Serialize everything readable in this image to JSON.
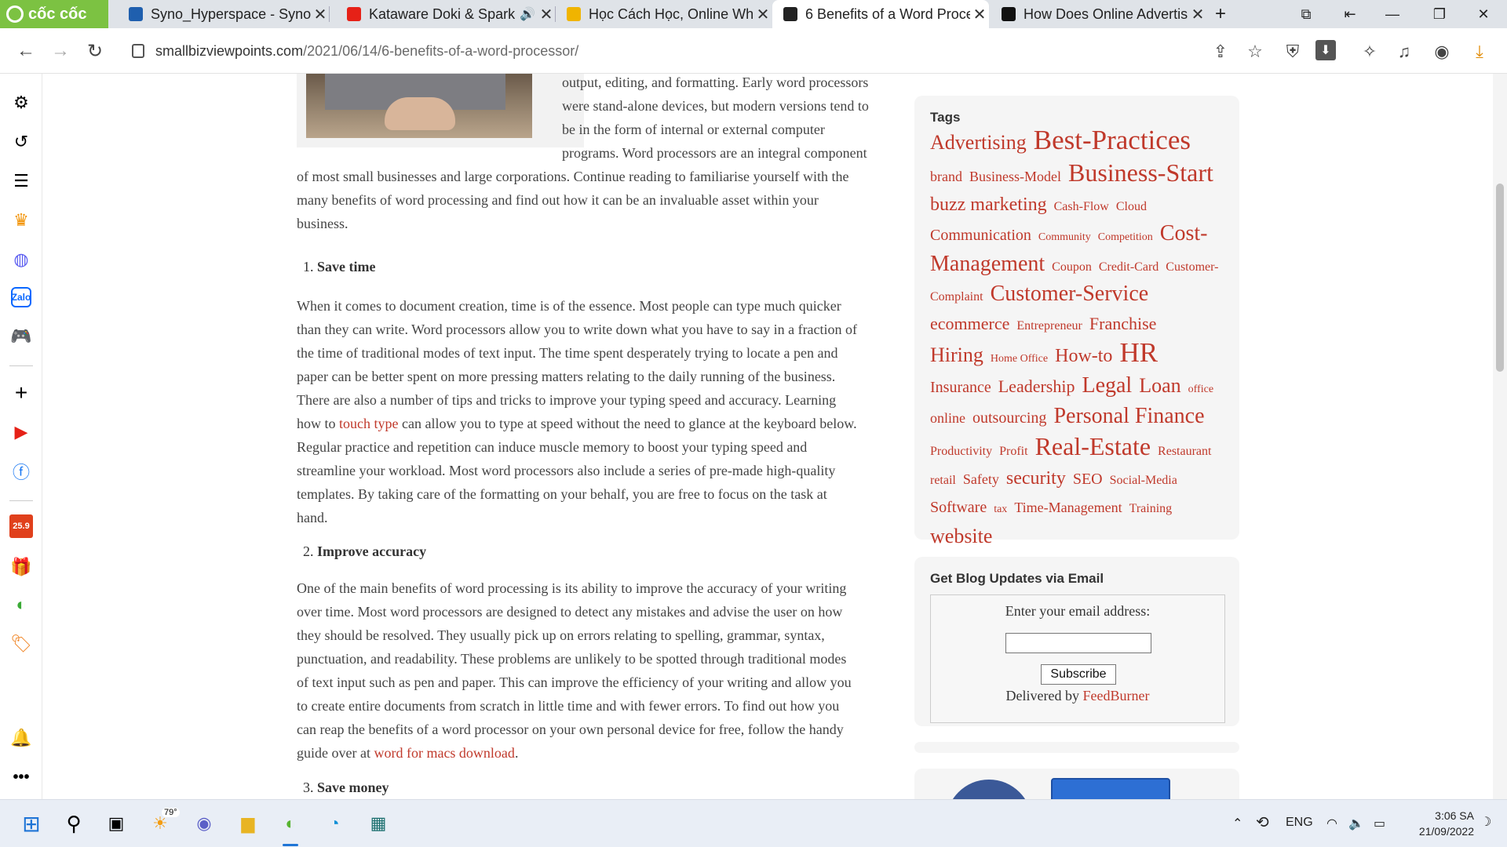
{
  "browser": {
    "logo": "cốc cốc",
    "tabs": [
      {
        "title": "Syno_Hyperspace - Synolo",
        "fav_color": "#1f5fae"
      },
      {
        "title": "Kataware Doki & Spark",
        "fav_color": "#e62117"
      },
      {
        "title": "Học Cách Học, Online Wh",
        "fav_color": "#f0b400"
      },
      {
        "title": "6 Benefits of a Word Proce",
        "fav_color": "#222222"
      },
      {
        "title": "How Does Online Advertis",
        "fav_color": "#111111"
      }
    ],
    "url_domain": "smallbizviewpoints.com",
    "url_path": "/2021/06/14/6-benefits-of-a-word-processor/"
  },
  "article": {
    "intro_lines": [
      "output, editing, and formatting. Early word processors",
      "were stand-alone devices, but modern versions tend to",
      "be in the form of internal or external computer",
      "programs. Word processors are an integral component"
    ],
    "intro_rest": [
      "of most small businesses and large corporations. Continue reading to familiarise yourself with the",
      "many benefits of word processing and find out how it can be an invaluable asset within your",
      "business."
    ],
    "h1_num": "1.",
    "h1": "Save time",
    "p1": [
      "When it comes to document creation, time is of the essence. Most people can type much quicker",
      "than they can write. Word processors allow you to write down what you have to say in a fraction of",
      "the time of traditional modes of text input. The time spent desperately trying to locate a pen and",
      "paper can be better spent on more pressing matters relating to the daily running of the business.",
      "There are also a number of tips and tricks to improve your typing speed and accuracy. Learning"
    ],
    "p1_link_pre": "how to ",
    "p1_link": "touch type",
    "p1_link_post": " can allow you to type at speed without the need to glance at the keyboard below.",
    "p1_tail": [
      "Regular practice and repetition can induce muscle memory to boost your typing speed and",
      "streamline your workload. Most word processors also include a series of pre-made high-quality",
      "templates. By taking care of the formatting on your behalf, you are free to focus on the task at",
      "hand."
    ],
    "h2_num": "2.",
    "h2": "Improve accuracy",
    "p2": [
      "One of the main benefits of word processing is its ability to improve the accuracy of your writing",
      "over time. Most word processors are designed to detect any mistakes and advise the user on how",
      "they should be resolved. They usually pick up on errors relating to spelling, grammar, syntax,",
      "punctuation, and readability. These problems are unlikely to be spotted through traditional modes",
      "of text input such as pen and paper. This can improve the efficiency of your writing and allow you",
      "to create entire documents from scratch in little time and with fewer errors. To find out how you",
      "can reap the benefits of a word processor on your own personal device for free, follow the handy"
    ],
    "p2_link_pre": "guide over at ",
    "p2_link": "word for macs download",
    "p2_link_post": ".",
    "h3_num": "3.",
    "h3": "Save money"
  },
  "sidebar_widgets": {
    "tags_title": "Tags",
    "tags": [
      {
        "t": "Advertising",
        "s": "s26"
      },
      {
        "t": "Best-Practices",
        "s": "s34"
      },
      {
        "t": "brand",
        "s": "s18"
      },
      {
        "t": "Business-Model",
        "s": "s18"
      },
      {
        "t": "Business-Start",
        "s": "s32"
      },
      {
        "t": "buzz marketing",
        "s": "s24"
      },
      {
        "t": "Cash-Flow",
        "s": "s16"
      },
      {
        "t": "Cloud",
        "s": "s16"
      },
      {
        "t": "Communication",
        "s": "s20"
      },
      {
        "t": "Community",
        "s": "s14"
      },
      {
        "t": "Competition",
        "s": "s14"
      },
      {
        "t": "Cost-Management",
        "s": "s28"
      },
      {
        "t": "Coupon",
        "s": "s16"
      },
      {
        "t": "Credit-Card",
        "s": "s16"
      },
      {
        "t": "Customer-Complaint",
        "s": "s16"
      },
      {
        "t": "Customer-Service",
        "s": "s28"
      },
      {
        "t": "ecommerce",
        "s": "s22"
      },
      {
        "t": "Entrepreneur",
        "s": "s30"
      },
      {
        "t": "Franchise",
        "s": "s22"
      },
      {
        "t": "Hiring",
        "s": "s26"
      },
      {
        "t": "Home Office",
        "s": "s14"
      },
      {
        "t": "How-to",
        "s": "s24"
      },
      {
        "t": "HR",
        "s": "s34"
      },
      {
        "t": "Insurance",
        "s": "s20"
      },
      {
        "t": "Leadership",
        "s": "s22"
      },
      {
        "t": "Legal",
        "s": "s28"
      },
      {
        "t": "Loan",
        "s": "s26"
      },
      {
        "t": "office",
        "s": "s14"
      },
      {
        "t": "online",
        "s": "s18"
      },
      {
        "t": "outsourcing",
        "s": "s20"
      },
      {
        "t": "Personal Finance",
        "s": "s28"
      },
      {
        "t": "Productivity",
        "s": "s30"
      },
      {
        "t": "Profit",
        "s": "s16"
      },
      {
        "t": "Real-Estate",
        "s": "s32"
      },
      {
        "t": "Restaurant",
        "s": "s16"
      },
      {
        "t": "retail",
        "s": "s16"
      },
      {
        "t": "Safety",
        "s": "s18"
      },
      {
        "t": "security",
        "s": "s24"
      },
      {
        "t": "SEO",
        "s": "s20"
      },
      {
        "t": "Social-Media",
        "s": "s30"
      },
      {
        "t": "Software",
        "s": "s20"
      },
      {
        "t": "tax",
        "s": "s14"
      },
      {
        "t": "Time-Management",
        "s": "s18"
      },
      {
        "t": "Training",
        "s": "s16"
      },
      {
        "t": "website",
        "s": "s26"
      }
    ],
    "email_title": "Get Blog Updates via Email",
    "email_prompt": "Enter your email address:",
    "subscribe_label": "Subscribe",
    "delivered_pre": "Delivered by ",
    "delivered_link": "FeedBurner"
  },
  "taskbar": {
    "weather": "79°",
    "lang": "ENG",
    "time": "3:06 SA",
    "date": "21/09/2022"
  },
  "left_sidebar": {
    "shop_badge": "25.9"
  }
}
